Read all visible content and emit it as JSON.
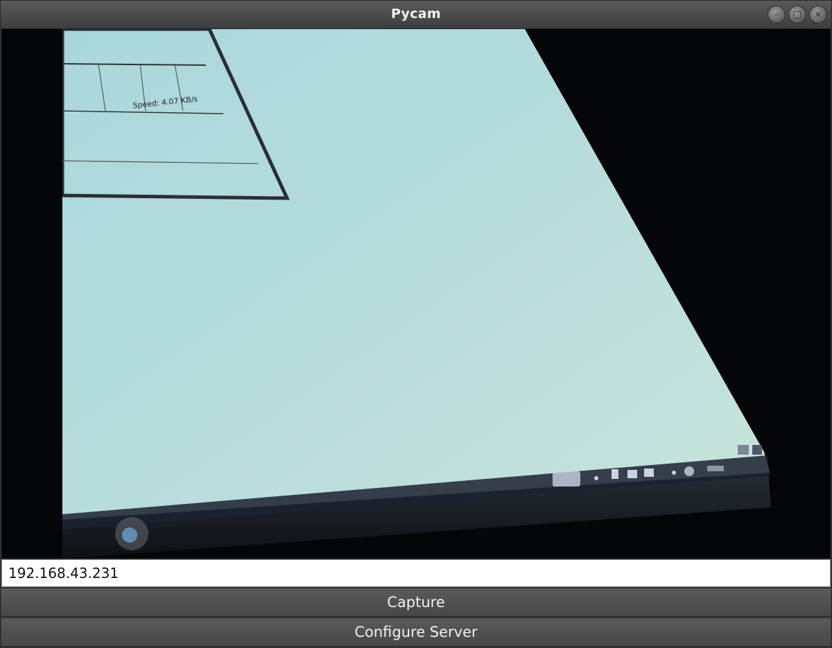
{
  "window": {
    "title": "Pycam",
    "controls": [
      {
        "name": "minimize",
        "glyph": "–"
      },
      {
        "name": "maximize",
        "glyph": "□"
      },
      {
        "name": "close",
        "glyph": "×"
      }
    ]
  },
  "camera_feed": {
    "screen_text": {
      "speed_readout": "Speed: 4.07 KB/s"
    }
  },
  "server": {
    "ip_value": "192.168.43.231"
  },
  "buttons": {
    "capture_label": "Capture",
    "configure_label": "Configure Server"
  },
  "colors": {
    "titlebar": "#4a4a4a",
    "button_bg": "#525252",
    "button_text": "#f0f0f0",
    "feed_background": "#050608",
    "monitor_screen": "#b9dcdf"
  }
}
